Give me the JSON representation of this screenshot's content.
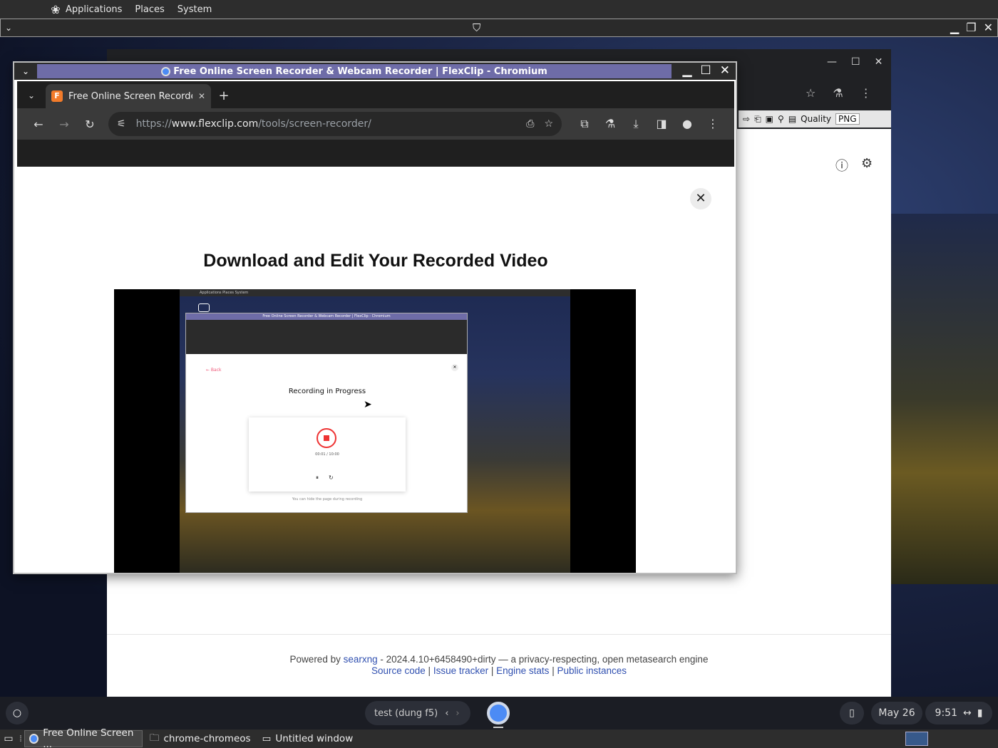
{
  "top_panel": {
    "menus": [
      "Applications",
      "Places",
      "System"
    ]
  },
  "bg_window": {
    "toolbar": {
      "quality_label": "Quality",
      "format": "PNG"
    },
    "footer": {
      "powered_prefix": "Powered by",
      "engine_link": "searxng",
      "version_text": "- 2024.4.10+6458490+dirty — a privacy-respecting, open metasearch engine",
      "links": [
        "Source code",
        "Issue tracker",
        "Engine stats",
        "Public instances"
      ],
      "separator": "|"
    }
  },
  "main_window": {
    "title": "Free Online Screen Recorder & Webcam Recorder | FlexClip - Chromium",
    "tab": {
      "favicon": "F",
      "label": "Free Online Screen Recorder"
    },
    "url": {
      "scheme": "https://",
      "host": "www.flexclip.com",
      "path": "/tools/screen-recorder/"
    },
    "page": {
      "heading": "Download and Edit Your Recorded Video"
    },
    "video": {
      "top_bar_text": "Applications   Places   System",
      "title_text": "Free Online Screen Recorder & Webcam Recorder | FlexClip - Chromium",
      "back_text": "← Back",
      "recording_label": "Recording in Progress",
      "timer": "00:01 / 10:00",
      "hint": "You can hide the page during recording"
    }
  },
  "shelf": {
    "desk_name": "test (dung f5)",
    "date": "May 26",
    "time": "9:51"
  },
  "taskbar": {
    "items": [
      {
        "label": "Free Online Screen ...",
        "active": true
      },
      {
        "label": "chrome-chromeos",
        "active": false
      },
      {
        "label": "Untitled window",
        "active": false
      }
    ]
  },
  "colors": {
    "title_strip": "#6e6ca8",
    "chrome_dark": "#1f1f1f",
    "link_blue": "#3050b0",
    "record_red": "#e33333"
  }
}
